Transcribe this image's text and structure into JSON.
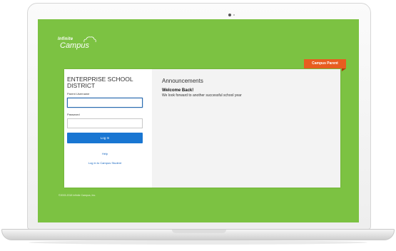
{
  "brand": {
    "logo_small": "Infinite",
    "logo_big": "Campus",
    "primary_color": "#7cc242",
    "accent_color": "#e85d20",
    "button_color": "#1976d2"
  },
  "portal_tag": "Campus Parent",
  "login": {
    "district": "ENTERPRISE SCHOOL DISTRICT",
    "username_label": "Parent Username",
    "username_value": "",
    "password_label": "Password",
    "password_value": "",
    "button_label": "Log In",
    "help_link": "Help",
    "student_link": "Log in to Campus Student"
  },
  "announcements": {
    "title": "Announcements",
    "heading": "Welcome Back!",
    "text": "We look forward to another successful school year"
  },
  "footer": {
    "copyright": "©2003-2018 Infinite Campus, Inc."
  }
}
